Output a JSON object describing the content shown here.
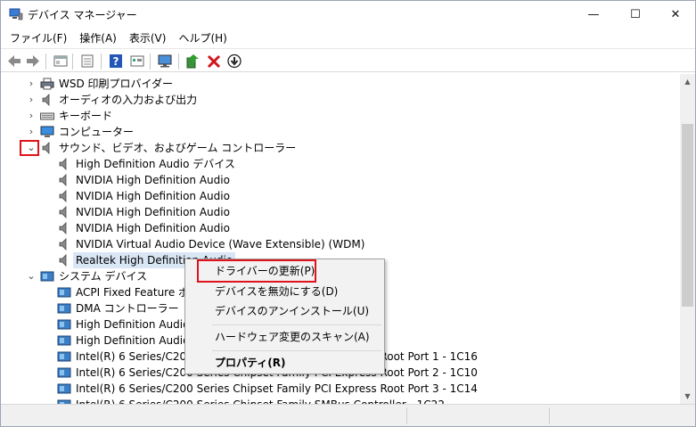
{
  "window": {
    "title": "デバイス マネージャー",
    "icon": "device-manager-icon",
    "controls": [
      "—",
      "☐",
      "✕"
    ]
  },
  "menubar": {
    "items": [
      "ファイル(F)",
      "操作(A)",
      "表示(V)",
      "ヘルプ(H)"
    ]
  },
  "toolbar": {
    "buttons": [
      "back-icon",
      "forward-icon",
      "show-tree-icon",
      "properties-icon",
      "help-icon",
      "view-icon",
      "monitor-icon",
      "update-driver-icon",
      "uninstall-icon",
      "disable-icon"
    ]
  },
  "tree": {
    "categories": [
      {
        "label": "WSD 印刷プロバイダー",
        "icon": "printer-icon",
        "expanded": false
      },
      {
        "label": "オーディオの入力および出力",
        "icon": "speaker-icon",
        "expanded": false
      },
      {
        "label": "キーボード",
        "icon": "keyboard-icon",
        "expanded": false
      },
      {
        "label": "コンピューター",
        "icon": "computer-icon",
        "expanded": false
      },
      {
        "label": "サウンド、ビデオ、およびゲーム コントローラー",
        "icon": "speaker-icon",
        "expanded": true
      }
    ],
    "sound_children": [
      "High Definition Audio デバイス",
      "NVIDIA High Definition Audio",
      "NVIDIA High Definition Audio",
      "NVIDIA High Definition Audio",
      "NVIDIA High Definition Audio",
      "NVIDIA Virtual Audio Device (Wave Extensible) (WDM)",
      "Realtek High Definition Audio"
    ],
    "system_category": "システム デバイス",
    "system_children": [
      "ACPI Fixed Feature ボタン",
      "DMA コントローラー",
      "High Definition Audio コントローラー",
      "High Definition Audio コントローラー",
      "Intel(R) 6 Series/C200 Series Chipset Family PCI Express Root Port 1 - 1C16",
      "Intel(R) 6 Series/C200 Series Chipset Family PCI Express Root Port 2 - 1C10",
      "Intel(R) 6 Series/C200 Series Chipset Family PCI Express Root Port 3 - 1C14",
      "Intel(R) 6 Series/C200 Series Chipset Family SMBus Controller - 1C22"
    ]
  },
  "context_menu": {
    "items": [
      "ドライバーの更新(P)",
      "デバイスを無効にする(D)",
      "デバイスのアンインストール(U)",
      "ハードウェア変更のスキャン(A)",
      "プロパティ(R)"
    ]
  },
  "colors": {
    "highlight_box": "#e0121b",
    "selection": "#d9e6f5"
  }
}
